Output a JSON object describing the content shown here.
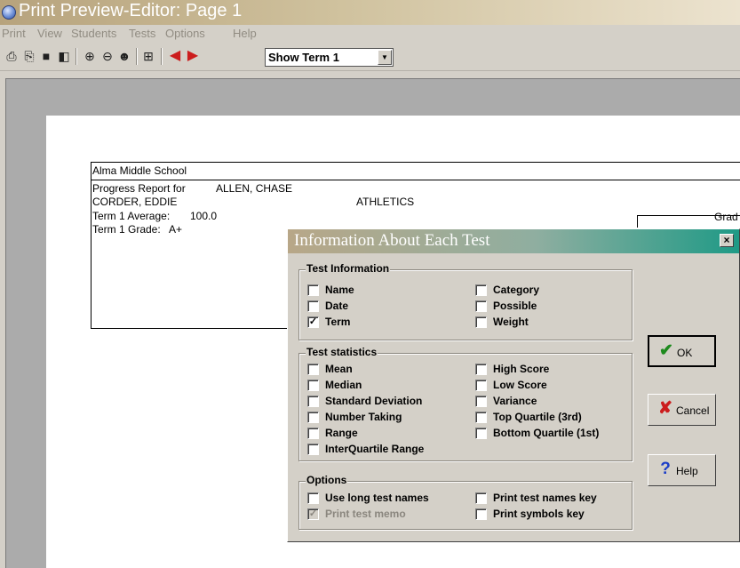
{
  "window": {
    "title": "Print Preview-Editor:  Page 1"
  },
  "menu": {
    "items": [
      "Print",
      "View",
      "Students",
      "Tests",
      "Options",
      "Help"
    ]
  },
  "toolbar": {
    "icons": [
      "printer-icon",
      "printer-setup-icon",
      "save-icon",
      "copy-icon",
      "zoom-in-icon",
      "zoom-out-icon",
      "student-icon",
      "fit-page-icon",
      "previous-arrow-icon",
      "next-arrow-icon"
    ],
    "term_select": {
      "value": "Show Term 1",
      "arrow": "▼"
    }
  },
  "report": {
    "school": "Alma Middle School",
    "progress_label": "Progress Report for",
    "student": "ALLEN, CHASE",
    "teacher": "CORDER, EDDIE",
    "class": "ATHLETICS",
    "average_label": "Term 1 Average:",
    "average_value": "100.0",
    "grade_label": "Term 1 Grade:",
    "grade_value": "A+",
    "grade_header": "Grad"
  },
  "dialog": {
    "title": "Information About Each Test",
    "close": "×",
    "test_information": {
      "label": "Test Information",
      "items": [
        {
          "label": "Name",
          "checked": false
        },
        {
          "label": "Date",
          "checked": false
        },
        {
          "label": "Term",
          "checked": true
        },
        {
          "label": "Category",
          "checked": false
        },
        {
          "label": "Possible",
          "checked": false
        },
        {
          "label": "Weight",
          "checked": false
        }
      ]
    },
    "test_statistics": {
      "label": "Test statistics",
      "items": [
        {
          "label": "Mean",
          "checked": false
        },
        {
          "label": "Median",
          "checked": false
        },
        {
          "label": "Standard Deviation",
          "checked": false
        },
        {
          "label": "Number Taking",
          "checked": false
        },
        {
          "label": "Range",
          "checked": false
        },
        {
          "label": "InterQuartile Range",
          "checked": false
        },
        {
          "label": "High Score",
          "checked": false
        },
        {
          "label": "Low Score",
          "checked": false
        },
        {
          "label": "Variance",
          "checked": false
        },
        {
          "label": "Top Quartile (3rd)",
          "checked": false
        },
        {
          "label": "Bottom Quartile (1st)",
          "checked": false
        }
      ]
    },
    "options": {
      "label": "Options",
      "items": [
        {
          "label": "Use long test names",
          "checked": false,
          "disabled": false
        },
        {
          "label": "Print test memo",
          "checked": true,
          "disabled": true
        },
        {
          "label": "Print test names key",
          "checked": false,
          "disabled": false
        },
        {
          "label": "Print symbols key",
          "checked": false,
          "disabled": false
        }
      ]
    },
    "buttons": {
      "ok": {
        "label": "OK",
        "icon": "check-icon"
      },
      "cancel": {
        "label": "Cancel",
        "icon": "x-icon"
      },
      "help": {
        "label": "Help",
        "icon": "question-icon"
      }
    }
  },
  "colors": {
    "check": "#1e8a1e",
    "cancel_x": "#cc1d1d",
    "help": "#1d3fc8"
  }
}
